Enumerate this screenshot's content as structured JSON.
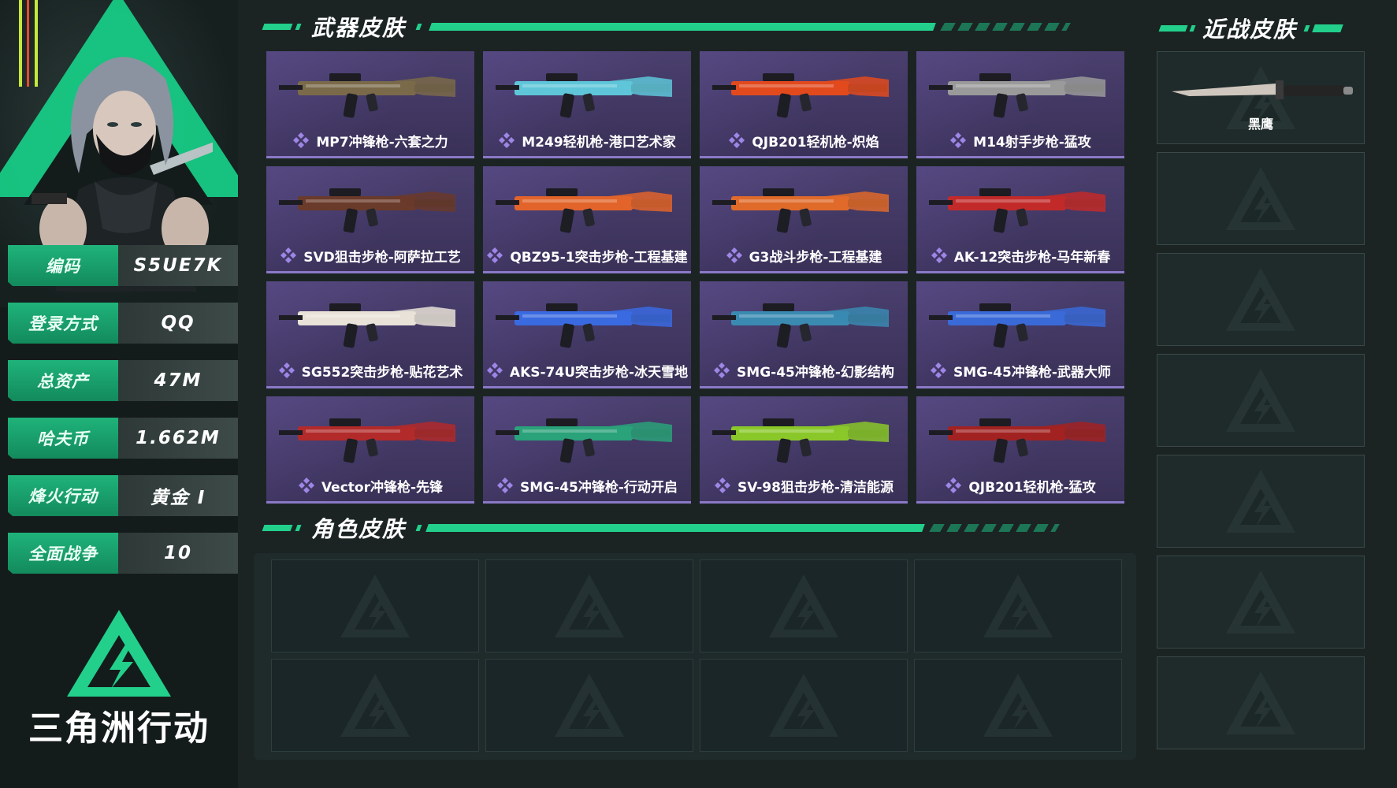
{
  "player": {
    "stats": [
      {
        "label": "编码",
        "value": "S5UE7K"
      },
      {
        "label": "登录方式",
        "value": "QQ"
      },
      {
        "label": "总资产",
        "value": "47M"
      },
      {
        "label": "哈夫币",
        "value": "1.662M"
      },
      {
        "label": "烽火行动",
        "value": "黄金 I"
      },
      {
        "label": "全面战争",
        "value": "10"
      }
    ]
  },
  "brand": {
    "name": "三角洲行动"
  },
  "sections": {
    "weapon_skins": "武器皮肤",
    "character_skins": "角色皮肤",
    "melee_skins": "近战皮肤"
  },
  "weapons": [
    {
      "name": "MP7冲锋枪-六套之力",
      "color": "#7a6a4a"
    },
    {
      "name": "M249轻机枪-港口艺术家",
      "color": "#5ec6d8"
    },
    {
      "name": "QJB201轻机枪-炽焰",
      "color": "#e24a1e"
    },
    {
      "name": "M14射手步枪-猛攻",
      "color": "#9a9a9a"
    },
    {
      "name": "SVD狙击步枪-阿萨拉工艺",
      "color": "#6a3a2a"
    },
    {
      "name": "QBZ95-1突击步枪-工程基建",
      "color": "#e2642a"
    },
    {
      "name": "G3战斗步枪-工程基建",
      "color": "#e06a2a"
    },
    {
      "name": "AK-12突击步枪-马年新春",
      "color": "#c22a2a"
    },
    {
      "name": "SG552突击步枪-贴花艺术",
      "color": "#e8e2d8"
    },
    {
      "name": "AKS-74U突击步枪-冰天雪地",
      "color": "#3a6ae0"
    },
    {
      "name": "SMG-45冲锋枪-幻影结构",
      "color": "#3a8ab2"
    },
    {
      "name": "SMG-45冲锋枪-武器大师",
      "color": "#3a6ad8"
    },
    {
      "name": "Vector冲锋枪-先锋",
      "color": "#b22a2a"
    },
    {
      "name": "SMG-45冲锋枪-行动开启",
      "color": "#2aa27a"
    },
    {
      "name": "SV-98狙击步枪-清洁能源",
      "color": "#8ac82a"
    },
    {
      "name": "QJB201轻机枪-猛攻",
      "color": "#a22222"
    }
  ],
  "character_slots": 8,
  "melee": [
    {
      "name": "黑鹰"
    },
    {
      "name": ""
    },
    {
      "name": ""
    },
    {
      "name": ""
    },
    {
      "name": ""
    },
    {
      "name": ""
    },
    {
      "name": ""
    }
  ],
  "colors": {
    "accent": "#22d08c",
    "card": "#4a3f6e",
    "background": "#1b2423"
  }
}
